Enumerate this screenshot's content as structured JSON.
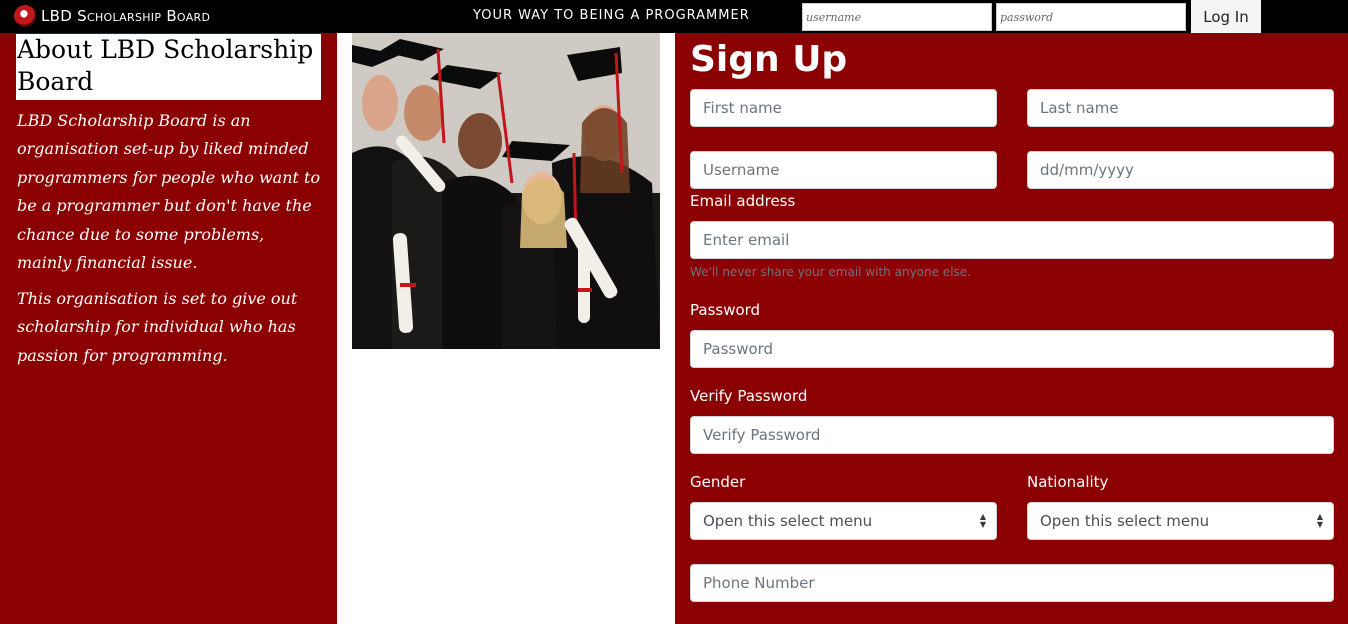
{
  "header": {
    "brand": "LBD Scholarship Board",
    "tagline": "YOUR WAY TO BEING A PROGRAMMER",
    "username_placeholder": "username",
    "password_placeholder": "password",
    "login_label": "Log In"
  },
  "about": {
    "title": "About LBD Scholarship Board",
    "paragraph1": "LBD Scholarship Board is an organisation set-up by liked minded programmers for people who want to be a programmer but don't have the chance due to some problems, mainly financial issue.",
    "paragraph2": "This organisation is set to give out scholarship for individual who has passion for programming."
  },
  "signup": {
    "title": "Sign Up",
    "first_name_placeholder": "First name",
    "last_name_placeholder": "Last name",
    "username_placeholder": "Username",
    "dob_placeholder": "dd/mm/yyyy",
    "email_label": "Email address",
    "email_placeholder": "Enter email",
    "email_help": "We'll never share your email with anyone else.",
    "password_label": "Password",
    "password_placeholder": "Password",
    "verify_label": "Verify Password",
    "verify_placeholder": "Verify Password",
    "gender_label": "Gender",
    "gender_value": "Open this select menu",
    "nationality_label": "Nationality",
    "nationality_value": "Open this select menu",
    "phone_placeholder": "Phone Number"
  },
  "colors": {
    "topbar": "#000000",
    "panel": "#8b0000"
  }
}
